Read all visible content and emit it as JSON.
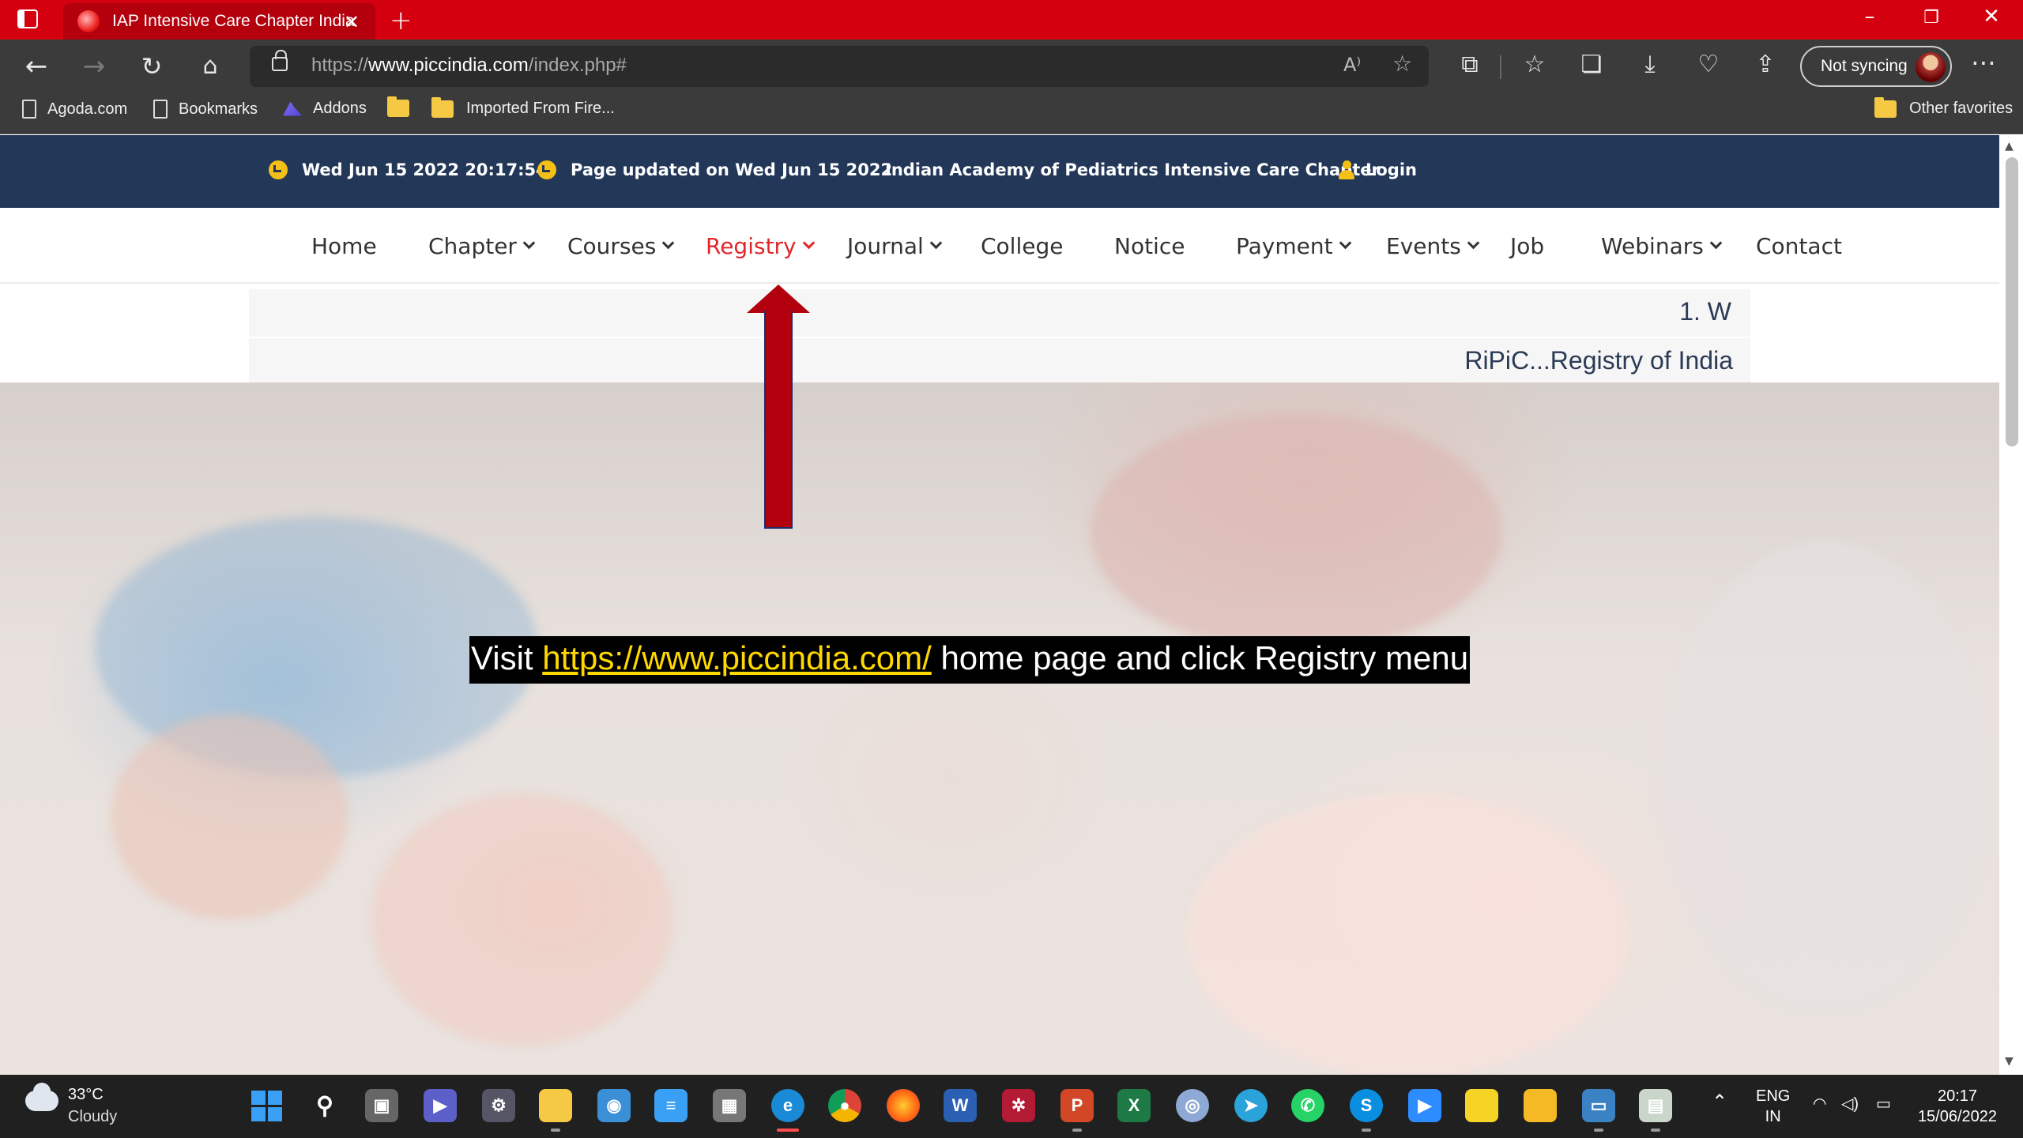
{
  "browser": {
    "tab_title": "IAP Intensive Care Chapter India",
    "url_prefix": "https://",
    "url_host": "www.piccindia.com",
    "url_path": "/index.php#",
    "profile_label": "Not syncing"
  },
  "bookmarks": [
    {
      "label": "Agoda.com",
      "icon": "page-icon"
    },
    {
      "label": "Bookmarks",
      "icon": "page-icon"
    },
    {
      "label": "Addons",
      "icon": "addon-icon"
    },
    {
      "label": "",
      "icon": "folder-icon"
    },
    {
      "label": "Imported From Fire...",
      "icon": "folder-icon"
    }
  ],
  "other_favorites": "Other favorites",
  "site": {
    "datetime": "Wed Jun 15 2022 20:17:54",
    "updated": "Page updated on Wed Jun 15 2022",
    "org_name": "Indian Academy of Pediatrics Intensive Care Chapter",
    "login": "Login",
    "nav": [
      "Home",
      "Chapter",
      "Courses",
      "Registry",
      "Journal",
      "College",
      "Notice",
      "Payment",
      "Events",
      "Job",
      "Webinars",
      "Contact"
    ],
    "nav_active": "Registry",
    "ticker": [
      "1. W",
      "RiPiC...Registry of India"
    ]
  },
  "annotation": {
    "caption_before": "Visit ",
    "caption_link": "https://www.piccindia.com/",
    "caption_after": " home page and click Registry menu",
    "arrow_color": "#b3000f",
    "caption_link_color": "#ffd800"
  },
  "taskbar": {
    "temperature": "33°C",
    "weather": "Cloudy",
    "lang": "ENG",
    "region": "IN",
    "time": "20:17",
    "date": "15/06/2022"
  },
  "colors": {
    "titlebar": "#d4000f",
    "site_header": "#233859",
    "nav_active": "#e2262a",
    "icon_accent": "#f4c018"
  }
}
